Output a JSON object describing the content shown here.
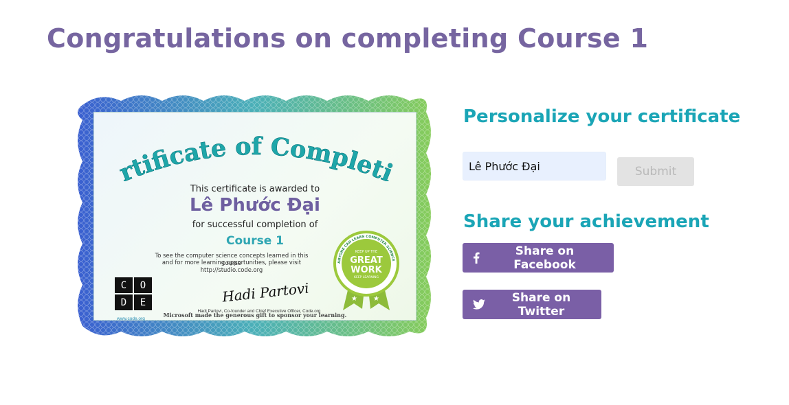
{
  "page": {
    "title": "Congratulations on completing Course 1"
  },
  "certificate": {
    "heading": "Certificate of Completion",
    "awarded_text": "This certificate is awarded to",
    "recipient_name": "Lê Phước Đại",
    "completion_text": "for successful completion of",
    "course_name": "Course 1",
    "visit_line_1": "To see the computer science concepts learned in this course",
    "visit_line_2": "and for more learning opportunities, please visit",
    "visit_line_3": "http://studio.code.org",
    "logo_letters": [
      "C",
      "O",
      "D",
      "E"
    ],
    "logo_url": "www.code.org",
    "signature": "Hadi Partovi",
    "signature_caption": "Hadi Partovi, Co-founder and Chief Executive Officer, Code.org",
    "sponsor_line": "Microsoft made the generous gift to sponsor your learning.",
    "badge": {
      "ring_text": "ANYONE CAN LEARN COMPUTER SCIENCE • CODE.ORG",
      "top_text": "KEEP UP THE",
      "main_line_1": "GREAT",
      "main_line_2": "WORK",
      "bottom_text": "KEEP LEARNING"
    }
  },
  "personalize": {
    "heading": "Personalize your certificate",
    "name_value": "Lê Phước Đại",
    "submit_label": "Submit"
  },
  "share": {
    "heading": "Share your achievement",
    "facebook_label": "Share on Facebook",
    "facebook_icon": "facebook-icon",
    "twitter_label": "Share on Twitter",
    "twitter_icon": "twitter-icon"
  },
  "colors": {
    "title": "#7665a0",
    "heading_teal": "#1aa5b6",
    "button_purple": "#7a5fa6",
    "input_bg": "#e8f0fe",
    "submit_disabled_bg": "#e3e3e3"
  }
}
